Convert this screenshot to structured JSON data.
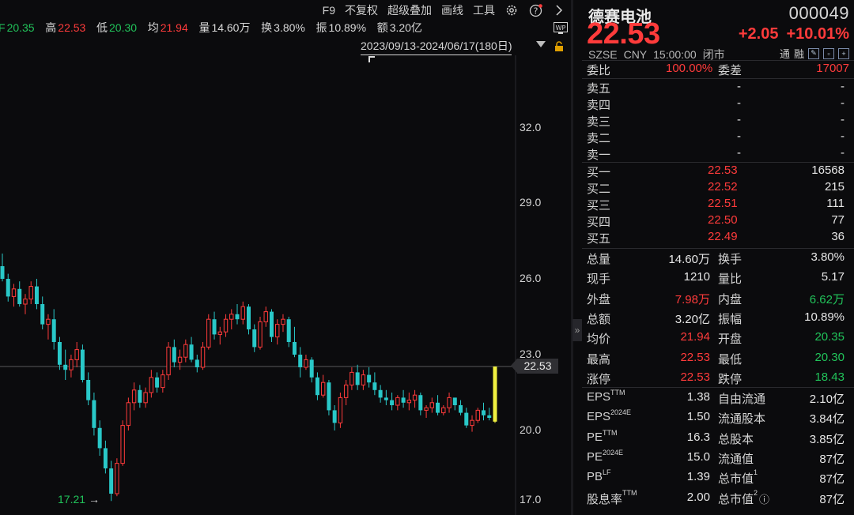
{
  "toolbar": {
    "items": [
      "F9",
      "不复权",
      "超级叠加",
      "画线",
      "工具"
    ],
    "icons": [
      "gear-icon",
      "help-icon",
      "chevron-right-icon"
    ]
  },
  "quote_line": {
    "open_label": "F",
    "open": "20.35",
    "high_label": "高",
    "high": "22.53",
    "low_label": "低",
    "low": "20.30",
    "avg_label": "均",
    "avg": "21.94",
    "volume_label": "量",
    "volume": "14.60万",
    "turnover_label": "换",
    "turnover": "3.80%",
    "amplitude_label": "振",
    "amplitude": "10.89%",
    "amount_label": "额",
    "amount": "3.20亿"
  },
  "range": "2023/09/13-2024/06/17(180日)",
  "wp_label": "WP",
  "y_axis": [
    "32.0",
    "29.0",
    "26.0",
    "23.0",
    "20.0",
    "17.0"
  ],
  "current_price_tag": "22.53",
  "low_marker": "17.21",
  "chart_data": {
    "type": "candlestick",
    "ylim": [
      16.8,
      33.5
    ],
    "current": 22.53,
    "period_low": 17.21,
    "candles": [
      [
        26.5,
        27.0,
        25.9,
        26.0
      ],
      [
        26.0,
        26.2,
        25.1,
        25.3
      ],
      [
        25.3,
        25.8,
        24.9,
        25.6
      ],
      [
        25.6,
        25.9,
        24.9,
        25.0
      ],
      [
        25.0,
        25.4,
        24.6,
        25.2
      ],
      [
        25.2,
        25.9,
        25.0,
        25.7
      ],
      [
        25.7,
        26.0,
        24.8,
        25.0
      ],
      [
        25.0,
        25.3,
        24.0,
        24.2
      ],
      [
        24.2,
        24.6,
        23.6,
        24.4
      ],
      [
        24.4,
        24.8,
        23.2,
        23.5
      ],
      [
        23.5,
        23.7,
        22.4,
        22.6
      ],
      [
        22.6,
        23.2,
        22.0,
        22.4
      ],
      [
        22.4,
        23.0,
        22.1,
        22.8
      ],
      [
        22.8,
        23.5,
        22.5,
        23.2
      ],
      [
        23.2,
        23.4,
        21.9,
        22.0
      ],
      [
        22.0,
        22.3,
        21.0,
        21.2
      ],
      [
        21.2,
        21.5,
        19.8,
        20.1
      ],
      [
        20.1,
        20.4,
        19.0,
        19.3
      ],
      [
        19.3,
        19.6,
        18.3,
        18.5
      ],
      [
        18.5,
        18.8,
        17.21,
        17.5
      ],
      [
        17.5,
        18.9,
        17.4,
        18.7
      ],
      [
        18.7,
        20.4,
        18.6,
        20.2
      ],
      [
        20.2,
        21.3,
        20.0,
        21.1
      ],
      [
        21.1,
        21.9,
        20.8,
        21.6
      ],
      [
        21.6,
        21.8,
        20.9,
        21.1
      ],
      [
        21.1,
        21.7,
        20.9,
        21.5
      ],
      [
        21.5,
        22.4,
        21.3,
        22.1
      ],
      [
        22.1,
        22.3,
        21.5,
        21.7
      ],
      [
        21.7,
        22.4,
        21.5,
        22.2
      ],
      [
        22.2,
        23.5,
        22.0,
        23.3
      ],
      [
        23.3,
        23.6,
        22.5,
        22.7
      ],
      [
        22.7,
        23.2,
        22.4,
        22.9
      ],
      [
        22.9,
        23.6,
        22.7,
        23.4
      ],
      [
        23.4,
        23.7,
        22.7,
        22.8
      ],
      [
        22.8,
        23.0,
        22.3,
        22.5
      ],
      [
        22.5,
        23.5,
        22.4,
        23.3
      ],
      [
        23.3,
        24.6,
        23.2,
        24.4
      ],
      [
        24.4,
        24.7,
        23.6,
        23.8
      ],
      [
        23.8,
        24.1,
        23.4,
        23.9
      ],
      [
        23.9,
        24.6,
        23.7,
        24.4
      ],
      [
        24.4,
        24.8,
        24.0,
        24.6
      ],
      [
        24.6,
        25.0,
        24.2,
        24.4
      ],
      [
        24.4,
        25.1,
        24.2,
        24.9
      ],
      [
        24.9,
        25.0,
        23.8,
        24.0
      ],
      [
        24.0,
        24.2,
        23.1,
        23.3
      ],
      [
        23.3,
        24.5,
        23.2,
        24.3
      ],
      [
        24.3,
        24.9,
        24.1,
        24.7
      ],
      [
        24.7,
        24.8,
        23.5,
        23.7
      ],
      [
        23.7,
        24.4,
        23.4,
        24.2
      ],
      [
        24.2,
        24.6,
        23.9,
        24.4
      ],
      [
        24.4,
        24.5,
        23.3,
        23.5
      ],
      [
        23.5,
        24.1,
        22.9,
        23.0
      ],
      [
        23.0,
        23.3,
        22.1,
        22.5
      ],
      [
        22.5,
        23.0,
        22.4,
        22.8
      ],
      [
        22.8,
        22.9,
        21.9,
        22.1
      ],
      [
        22.1,
        22.3,
        21.2,
        21.4
      ],
      [
        21.4,
        22.2,
        21.3,
        21.9
      ],
      [
        21.9,
        22.0,
        20.6,
        20.8
      ],
      [
        20.8,
        21.0,
        20.0,
        20.3
      ],
      [
        20.3,
        21.5,
        20.1,
        21.3
      ],
      [
        21.3,
        22.0,
        21.0,
        21.8
      ],
      [
        21.8,
        22.5,
        21.6,
        22.3
      ],
      [
        22.3,
        22.6,
        21.6,
        21.8
      ],
      [
        21.8,
        22.4,
        21.6,
        22.2
      ],
      [
        22.2,
        22.5,
        21.7,
        21.9
      ],
      [
        21.9,
        22.3,
        21.4,
        21.6
      ],
      [
        21.6,
        21.8,
        21.1,
        21.3
      ],
      [
        21.3,
        21.6,
        21.0,
        21.2
      ],
      [
        21.2,
        21.5,
        20.8,
        21.0
      ],
      [
        21.0,
        21.4,
        20.8,
        21.3
      ],
      [
        21.3,
        21.6,
        20.9,
        21.1
      ],
      [
        21.1,
        21.5,
        20.8,
        21.2
      ],
      [
        21.2,
        21.6,
        20.9,
        21.4
      ],
      [
        21.4,
        21.5,
        20.6,
        20.8
      ],
      [
        20.8,
        21.0,
        20.5,
        20.9
      ],
      [
        20.9,
        21.3,
        20.7,
        21.1
      ],
      [
        21.1,
        21.4,
        20.6,
        20.7
      ],
      [
        20.7,
        21.0,
        20.6,
        20.9
      ],
      [
        20.9,
        21.5,
        20.7,
        21.3
      ],
      [
        21.3,
        21.3,
        20.8,
        21.0
      ],
      [
        21.0,
        21.2,
        20.6,
        20.7
      ],
      [
        20.7,
        20.9,
        20.1,
        20.2
      ],
      [
        20.2,
        20.6,
        19.95,
        20.4
      ],
      [
        20.4,
        20.9,
        20.3,
        20.8
      ],
      [
        20.8,
        21.1,
        20.4,
        20.6
      ],
      [
        20.6,
        20.9,
        20.4,
        20.5
      ],
      [
        20.35,
        22.53,
        20.3,
        22.53
      ]
    ]
  },
  "stock": {
    "name": "德赛电池",
    "code": "000049",
    "price": "22.53",
    "change": "+2.05",
    "change_pct": "+10.01%",
    "exchange": "SZSE",
    "currency": "CNY",
    "time": "15:00:00",
    "status": "闭市",
    "badges": [
      "通",
      "融"
    ]
  },
  "order_ratio": {
    "ratio_label": "委比",
    "ratio": "100.00%",
    "diff_label": "委差",
    "diff": "17007"
  },
  "asks": [
    {
      "label": "卖五",
      "price": "-",
      "volume": "-"
    },
    {
      "label": "卖四",
      "price": "-",
      "volume": "-"
    },
    {
      "label": "卖三",
      "price": "-",
      "volume": "-"
    },
    {
      "label": "卖二",
      "price": "-",
      "volume": "-"
    },
    {
      "label": "卖一",
      "price": "-",
      "volume": "-"
    }
  ],
  "bids": [
    {
      "label": "买一",
      "price": "22.53",
      "volume": "16568"
    },
    {
      "label": "买二",
      "price": "22.52",
      "volume": "215"
    },
    {
      "label": "买三",
      "price": "22.51",
      "volume": "111"
    },
    {
      "label": "买四",
      "price": "22.50",
      "volume": "77"
    },
    {
      "label": "买五",
      "price": "22.49",
      "volume": "36"
    }
  ],
  "stats": [
    {
      "l1": "总量",
      "v1": "14.60万",
      "c1": "white",
      "l2": "换手",
      "v2": "3.80%",
      "c2": "white"
    },
    {
      "l1": "现手",
      "v1": "1210",
      "c1": "white",
      "l2": "量比",
      "v2": "5.17",
      "c2": "white"
    },
    {
      "l1": "外盘",
      "v1": "7.98万",
      "c1": "red",
      "l2": "内盘",
      "v2": "6.62万",
      "c2": "green"
    },
    {
      "l1": "总额",
      "v1": "3.20亿",
      "c1": "white",
      "l2": "振幅",
      "v2": "10.89%",
      "c2": "white"
    },
    {
      "l1": "均价",
      "v1": "21.94",
      "c1": "red",
      "l2": "开盘",
      "v2": "20.35",
      "c2": "green"
    },
    {
      "l1": "最高",
      "v1": "22.53",
      "c1": "red",
      "l2": "最低",
      "v2": "20.30",
      "c2": "green"
    },
    {
      "l1": "涨停",
      "v1": "22.53",
      "c1": "red",
      "l2": "跌停",
      "v2": "18.43",
      "c2": "green"
    }
  ],
  "fundamentals": [
    {
      "l1": "EPS",
      "s1": "TTM",
      "v1": "1.38",
      "l2": "自由流通",
      "s2": "",
      "v2": "2.10亿"
    },
    {
      "l1": "EPS",
      "s1": "2024E",
      "v1": "1.50",
      "l2": "流通股本",
      "s2": "",
      "v2": "3.84亿"
    },
    {
      "l1": "PE",
      "s1": "TTM",
      "v1": "16.3",
      "l2": "总股本",
      "s2": "",
      "v2": "3.85亿"
    },
    {
      "l1": "PE",
      "s1": "2024E",
      "v1": "15.0",
      "l2": "流通值",
      "s2": "",
      "v2": "87亿"
    },
    {
      "l1": "PB",
      "s1": "LF",
      "v1": "1.39",
      "l2": "总市值",
      "s2": "1",
      "v2": "87亿"
    },
    {
      "l1": "股息率",
      "s1": "TTM",
      "v1": "2.00",
      "l2": "总市值",
      "s2": "2",
      "v2": "87亿"
    }
  ],
  "colors": {
    "up": "#ff3b3b",
    "down": "#21c35a",
    "flat_down": "#29c8c8",
    "highlight": "#f0f040",
    "background": "#0b0b0d"
  }
}
